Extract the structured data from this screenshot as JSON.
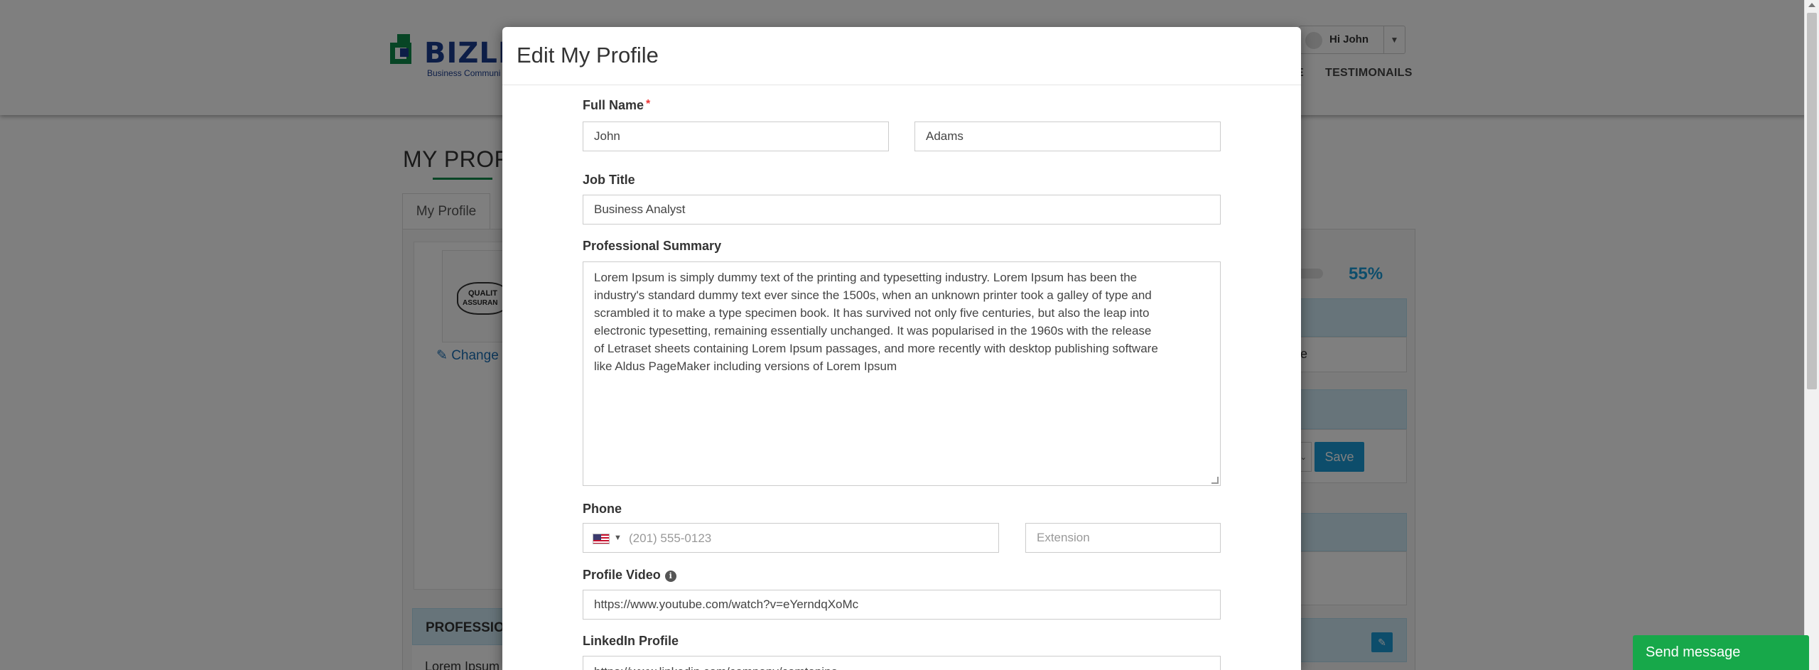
{
  "background": {
    "logo_text": "BIZLI",
    "logo_tagline": "Business Communi",
    "user_greeting": "Hi John",
    "nav": [
      "E",
      "TESTIMONAILS"
    ],
    "page_title": "MY PROFIL",
    "tab_my_profile": "My Profile",
    "change_photo": "Change",
    "photo_text_1": "QUALIT",
    "photo_text_2": "ASSURAN",
    "completion_percent": "55%",
    "partial_text": "e",
    "save_button": "Save",
    "professional_heading": "PROFESSION",
    "professional_body": "Lorem Ipsum"
  },
  "modal": {
    "title": "Edit My Profile",
    "full_name_label": "Full Name",
    "required_mark": "*",
    "first_name": "John",
    "last_name": "Adams",
    "job_title_label": "Job Title",
    "job_title": "Business Analyst",
    "summary_label": "Professional Summary",
    "summary_lines": [
      "Lorem Ipsum is simply dummy text of the printing and typesetting industry. Lorem Ipsum has been the",
      "industry's standard dummy text ever since the 1500s, when an unknown printer took a galley of type and",
      "scrambled it to make a type specimen book. It has survived not only five centuries, but also the leap into",
      "electronic typesetting, remaining essentially unchanged. It was popularised in the 1960s with the release",
      "of Letraset sheets containing Lorem Ipsum passages, and more recently with desktop publishing software",
      "like Aldus PageMaker including versions of Lorem Ipsum"
    ],
    "phone_label": "Phone",
    "phone_placeholder": "(201) 555-0123",
    "extension_placeholder": "Extension",
    "profile_video_label": "Profile Video",
    "profile_video": "https://www.youtube.com/watch?v=eYerndqXoMc",
    "linkedin_label": "LinkedIn Profile",
    "linkedin": "https://www.linkedin.com/company/comtopino"
  },
  "widgets": {
    "send_message": "Send message"
  },
  "colors": {
    "brand_green": "#0f8a4a",
    "brand_blue": "#1a3d8f",
    "accent_blue": "#1a9bd7",
    "send_green": "#17a84a"
  },
  "icons": [
    "user-avatar-icon",
    "chevron-down-icon",
    "edit-icon",
    "us-flag-icon",
    "info-icon"
  ]
}
